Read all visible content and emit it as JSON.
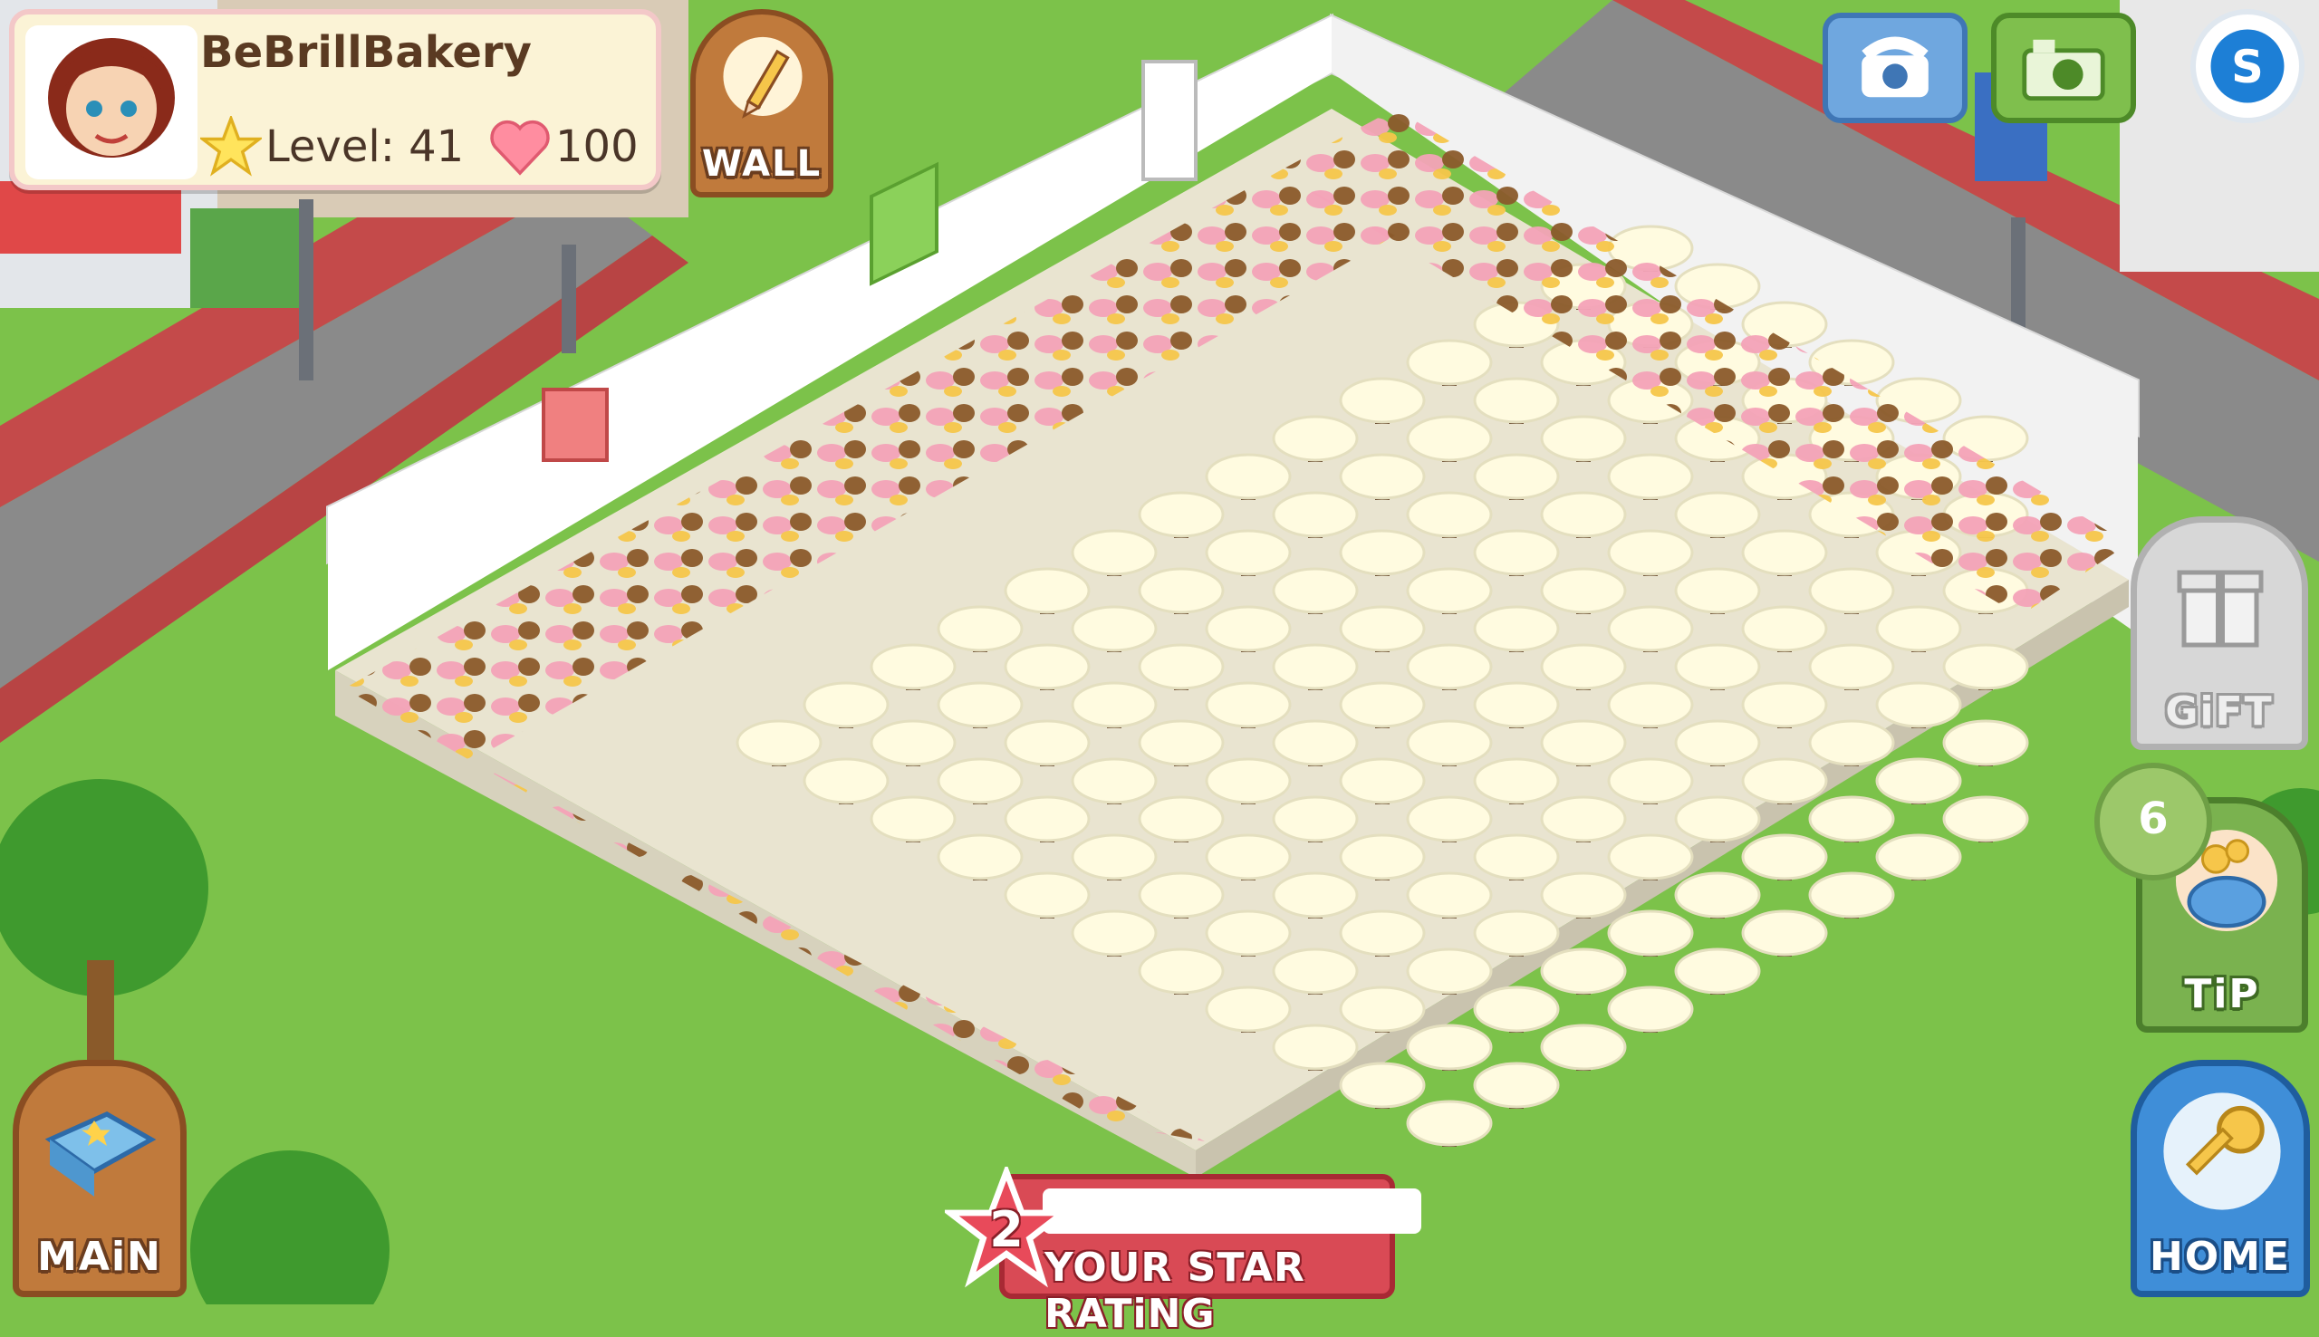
{
  "player": {
    "name": "BeBrillBakery",
    "level_text": "Level: 41",
    "hearts": "100"
  },
  "buttons": {
    "wall": "WALL",
    "main": "MAiN",
    "home": "HOME",
    "tip": "TiP",
    "gift": "GiFT"
  },
  "tip_count": "6",
  "star_rating": {
    "value": "2",
    "label": "YOUR STAR RATiNG",
    "progress_fraction": 0.0
  },
  "icons": [
    "phone-icon",
    "camera-icon",
    "social-s-icon",
    "pencil-icon",
    "book-icon",
    "key-icon",
    "coin-purse-icon",
    "gift-box-icon",
    "star-icon",
    "heart-icon"
  ],
  "colors": {
    "grass": "#7cc24a",
    "floor_table": "#fffbe0",
    "rating_red": "#d94a55",
    "tab_brown": "#c07a3c",
    "home_blue": "#3f8ed8",
    "tip_green": "#7ab24f"
  }
}
